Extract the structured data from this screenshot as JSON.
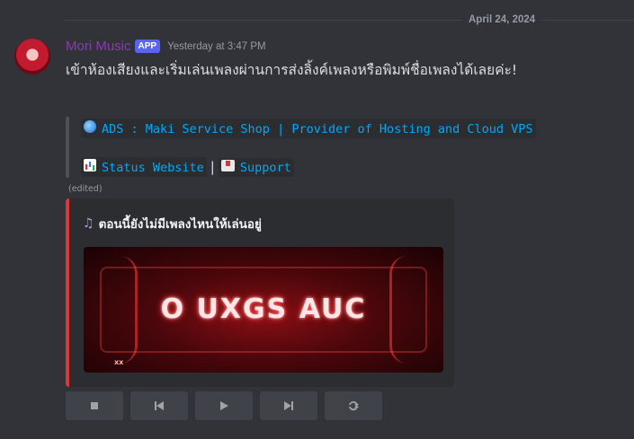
{
  "date_divider": "April 24, 2024",
  "message": {
    "username": "Mori Music",
    "badge": "APP",
    "timestamp": "Yesterday at 3:47 PM",
    "text": "เข้าห้องเสียงและเริ่มเล่นเพลงผ่านการส่งลิ้งค์เพลงหรือพิมพ์ชื่อเพลงได้เลยค่ะ!"
  },
  "quote": {
    "ads_text": "ADS : Maki Service Shop | Provider of Hosting and Cloud VPS",
    "status_link": "Status Website",
    "separator": "|",
    "support_link": "Support"
  },
  "edited_label": "(edited)",
  "embed": {
    "accent_color": "#e03636",
    "title": "ตอนนี้ยังไม่มีเพลงไหนให้เล่นอยู่",
    "image_text": "O UXGS AUC",
    "image_small_text": "xx"
  },
  "controls": [
    {
      "name": "stop-icon"
    },
    {
      "name": "previous-icon"
    },
    {
      "name": "play-icon"
    },
    {
      "name": "next-icon"
    },
    {
      "name": "loop-icon"
    }
  ]
}
